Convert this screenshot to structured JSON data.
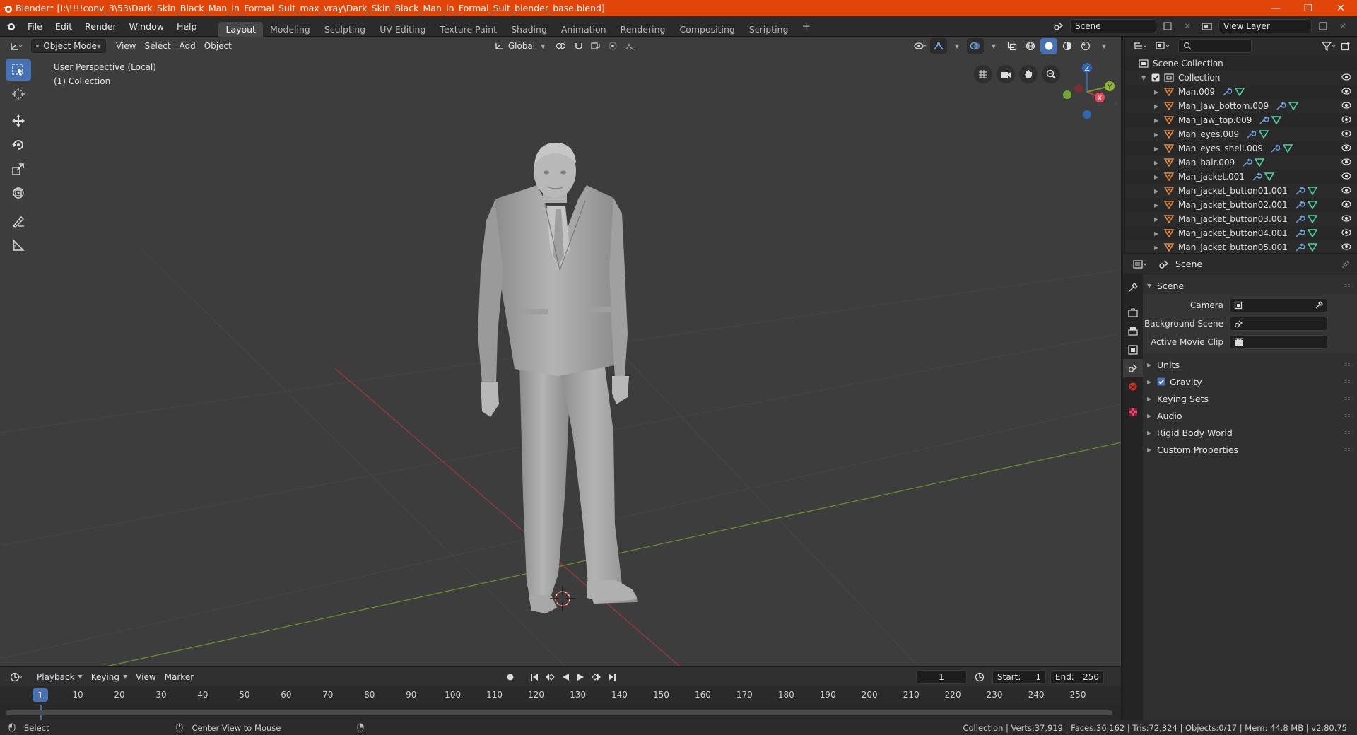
{
  "window": {
    "title": "Blender* [I:\\!!!!conv_3\\53\\Dark_Skin_Black_Man_in_Formal_Suit_max_vray\\Dark_Skin_Black_Man_in_Formal_Suit_blender_base.blend]",
    "minimize": "—",
    "maximize": "❐",
    "close": "✕"
  },
  "menu": [
    "File",
    "Edit",
    "Render",
    "Window",
    "Help"
  ],
  "workspaces": [
    {
      "label": "Layout",
      "active": true
    },
    {
      "label": "Modeling"
    },
    {
      "label": "Sculpting"
    },
    {
      "label": "UV Editing"
    },
    {
      "label": "Texture Paint"
    },
    {
      "label": "Shading"
    },
    {
      "label": "Animation"
    },
    {
      "label": "Rendering"
    },
    {
      "label": "Compositing"
    },
    {
      "label": "Scripting"
    }
  ],
  "scene_selector": {
    "value": "Scene"
  },
  "view_layer_selector": {
    "value": "View Layer"
  },
  "viewport_header": {
    "mode": "Object Mode",
    "menus": [
      "View",
      "Select",
      "Add",
      "Object"
    ],
    "transform_orientation": "Global"
  },
  "viewport": {
    "perspective_label": "User Perspective (Local)",
    "collection_label": "(1) Collection",
    "gizmo": {
      "z": "Z",
      "x": "X",
      "y": "Y"
    }
  },
  "timeline": {
    "menus": [
      "Playback",
      "Keying",
      "View",
      "Marker"
    ],
    "current_frame": "1",
    "start_label": "Start:",
    "start": "1",
    "end_label": "End:",
    "end": "250",
    "ticks": [
      "1",
      "10",
      "20",
      "30",
      "40",
      "50",
      "60",
      "70",
      "80",
      "90",
      "100",
      "110",
      "120",
      "130",
      "140",
      "150",
      "160",
      "170",
      "180",
      "190",
      "200",
      "210",
      "220",
      "230",
      "240",
      "250"
    ]
  },
  "statusbar": {
    "select": "Select",
    "center_view": "Center View to Mouse",
    "stats": "Collection | Verts:37,919 | Faces:36,162 | Tris:72,324 | Objects:0/17 | Mem: 44.8 MB | v2.80.75"
  },
  "outliner": {
    "root": "Scene Collection",
    "collection": "Collection",
    "items": [
      "Man.009",
      "Man_Jaw_bottom.009",
      "Man_Jaw_top.009",
      "Man_eyes.009",
      "Man_eyes_shell.009",
      "Man_hair.009",
      "Man_jacket.001",
      "Man_jacket_button01.001",
      "Man_jacket_button02.001",
      "Man_jacket_button03.001",
      "Man_jacket_button04.001",
      "Man_jacket_button05.001"
    ]
  },
  "properties": {
    "context": "Scene",
    "panel_title": "Scene",
    "camera_label": "Camera",
    "background_scene_label": "Background Scene",
    "active_movie_clip_label": "Active Movie Clip",
    "subpanels": [
      {
        "label": "Units",
        "check": false
      },
      {
        "label": "Gravity",
        "check": true
      },
      {
        "label": "Keying Sets",
        "check": false
      },
      {
        "label": "Audio",
        "check": false
      },
      {
        "label": "Rigid Body World",
        "check": false
      },
      {
        "label": "Custom Properties",
        "check": false
      }
    ]
  },
  "colors": {
    "titlebar": "#e2450a",
    "accent_blue": "#4772b3",
    "viewport_bg": "#3d3d3d",
    "axis_x": "#9a3a3f",
    "axis_y": "#6c8a2e",
    "mesh_icon": "#e8883c",
    "modifier_icon": "#6ea7e8",
    "data_icon": "#4fd1a3"
  }
}
